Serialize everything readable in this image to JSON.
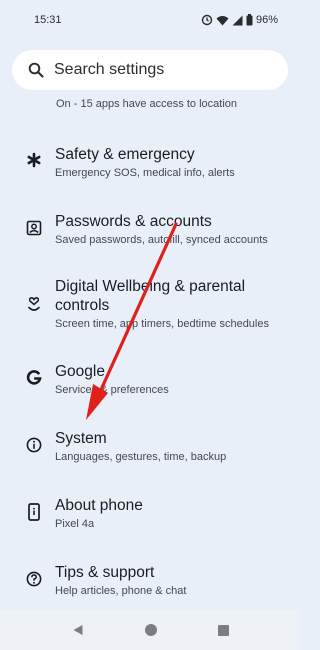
{
  "status": {
    "time": "15:31",
    "battery": "96%",
    "icons": [
      "do-not-disturb-icon",
      "wifi-icon",
      "signal-icon",
      "battery-icon"
    ]
  },
  "search": {
    "label": "Search settings",
    "icon": "search-icon"
  },
  "location_summary": "On - 15 apps have access to location",
  "items": [
    {
      "title": "Safety & emergency",
      "subtitle": "Emergency SOS, medical info, alerts",
      "icon": "asterisk-icon"
    },
    {
      "title": "Passwords & accounts",
      "subtitle": "Saved passwords, autofill, synced accounts",
      "icon": "account-box-icon"
    },
    {
      "title": "Digital Wellbeing & parental",
      "title2": "controls",
      "subtitle": "Screen time, app timers, bedtime schedules",
      "icon": "wellbeing-icon"
    },
    {
      "title": "Google",
      "subtitle": "Services & preferences",
      "icon": "google-icon"
    },
    {
      "title": "System",
      "subtitle": "Languages, gestures, time, backup",
      "icon": "info-icon"
    },
    {
      "title": "About phone",
      "subtitle": "Pixel 4a",
      "icon": "phone-icon"
    },
    {
      "title": "Tips & support",
      "subtitle": "Help articles, phone & chat",
      "icon": "help-icon"
    }
  ],
  "nav": [
    "back-icon",
    "home-icon",
    "recents-icon"
  ],
  "colors": {
    "background": "#e9eff9",
    "annotation_arrow": "#e0201b"
  }
}
